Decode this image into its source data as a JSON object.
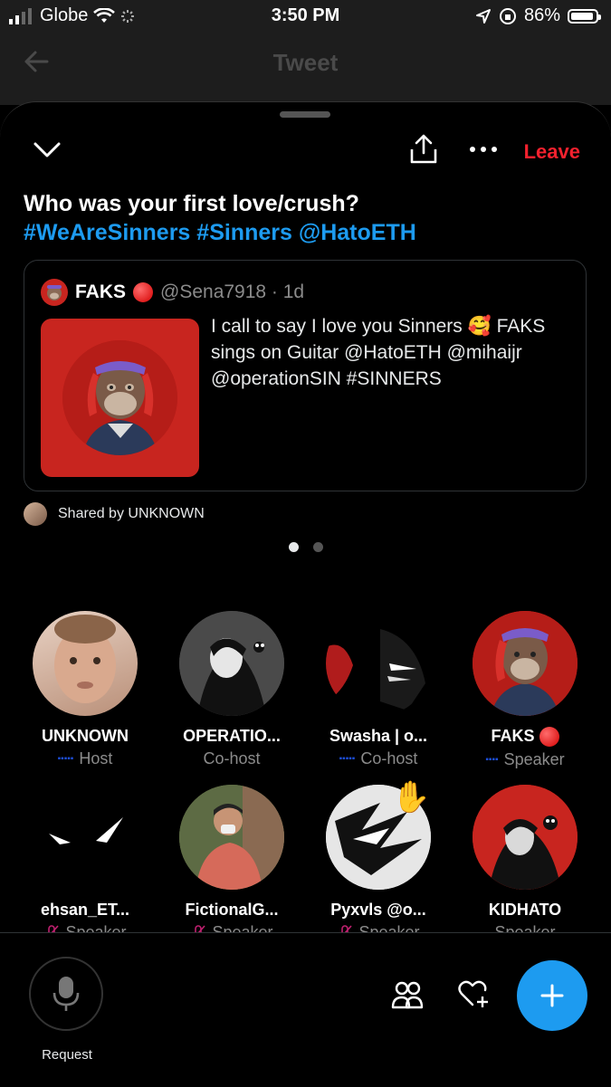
{
  "status": {
    "carrier": "Globe",
    "time": "3:50 PM",
    "battery": "86%",
    "battery_level": 0.86
  },
  "nav": {
    "title": "Tweet",
    "back_icon": "arrow-left-icon"
  },
  "space": {
    "leave_label": "Leave",
    "title": "Who was your first love/crush?",
    "hashtags": "#WeAreSinners #Sinners @HatoETH"
  },
  "tweet": {
    "name": "FAKS",
    "handle": "@Sena7918 · 1d",
    "text": "I call to say I love you Sinners 🥰 FAKS sings on Guitar @HatoETH @mihaijr @operationSIN #SINNERS"
  },
  "shared_by": "Shared by UNKNOWN",
  "pager": {
    "count": 2,
    "active": 0
  },
  "people": [
    {
      "name": "UNKNOWN",
      "role": "Host"
    },
    {
      "name": "OPERATIO...",
      "role": "Co-host"
    },
    {
      "name": "Swasha | o...",
      "role": "Co-host"
    },
    {
      "name": "FAKS",
      "role": "Speaker"
    },
    {
      "name": "ehsan_ET...",
      "role": "Speaker"
    },
    {
      "name": "FictionalG...",
      "role": "Speaker"
    },
    {
      "name": "Pyxvls @o...",
      "role": "Speaker"
    },
    {
      "name": "KIDHATO",
      "role": "Speaker"
    }
  ],
  "bottom": {
    "request_label": "Request"
  },
  "colors": {
    "accent": "#1d9bf0",
    "leave": "#f4212e",
    "muted_mic": "#c02070"
  }
}
